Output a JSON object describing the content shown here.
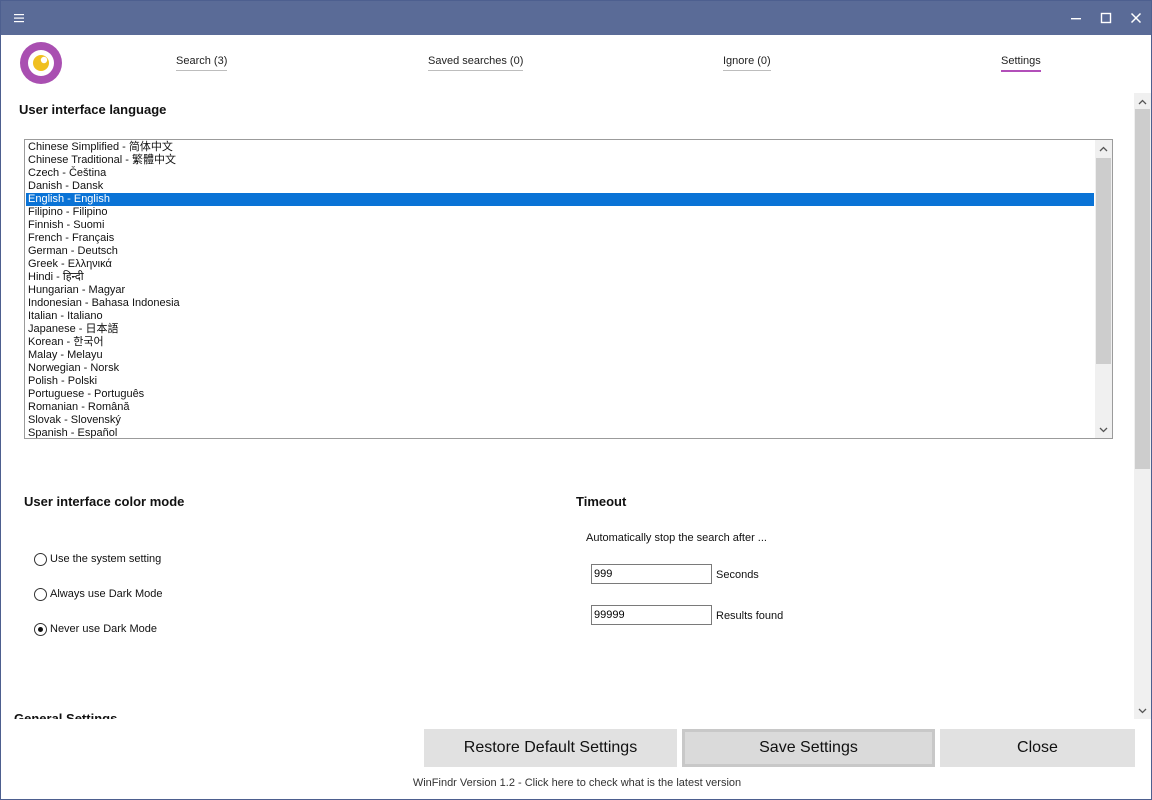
{
  "window": {
    "controls": {
      "menu": "≡",
      "minimize": "—",
      "maximize": "☐",
      "close": "✕"
    }
  },
  "tabs": [
    {
      "label": "Search (3)"
    },
    {
      "label": "Saved searches (0)"
    },
    {
      "label": "Ignore (0)"
    },
    {
      "label": "Settings",
      "active": true
    }
  ],
  "language_section": {
    "title": "User interface language",
    "items": [
      "Chinese Simplified - 简体中文",
      "Chinese Traditional - 繁體中文",
      "Czech - Čeština",
      "Danish - Dansk",
      "English - English",
      "Filipino - Filipino",
      "Finnish - Suomi",
      "French - Français",
      "German - Deutsch",
      "Greek - Ελληνικά",
      "Hindi - हिन्दी",
      "Hungarian - Magyar",
      "Indonesian - Bahasa Indonesia",
      "Italian - Italiano",
      "Japanese - 日本語",
      "Korean - 한국어",
      "Malay - Melayu",
      "Norwegian - Norsk",
      "Polish - Polski",
      "Portuguese - Português",
      "Romanian - Română",
      "Slovak - Slovenský",
      "Spanish - Español"
    ],
    "selected": "English - English"
  },
  "color_mode": {
    "title": "User interface color mode",
    "options": [
      {
        "label": "Use the system setting",
        "checked": false
      },
      {
        "label": "Always use Dark Mode",
        "checked": false
      },
      {
        "label": "Never use Dark Mode",
        "checked": true
      }
    ]
  },
  "timeout": {
    "title": "Timeout",
    "description": "Automatically stop the search after ...",
    "seconds_value": "999",
    "seconds_label": "Seconds",
    "results_value": "99999",
    "results_label": "Results found"
  },
  "general_settings": {
    "title": "General Settings"
  },
  "buttons": {
    "restore": "Restore Default Settings",
    "save": "Save Settings",
    "close": "Close"
  },
  "footer": {
    "version_text": "WinFindr Version 1.2 - Click here to check what is the latest version"
  },
  "colors": {
    "titlebar": "#5a6b97",
    "selection": "#0a73d6",
    "accent": "#b24fb9"
  }
}
